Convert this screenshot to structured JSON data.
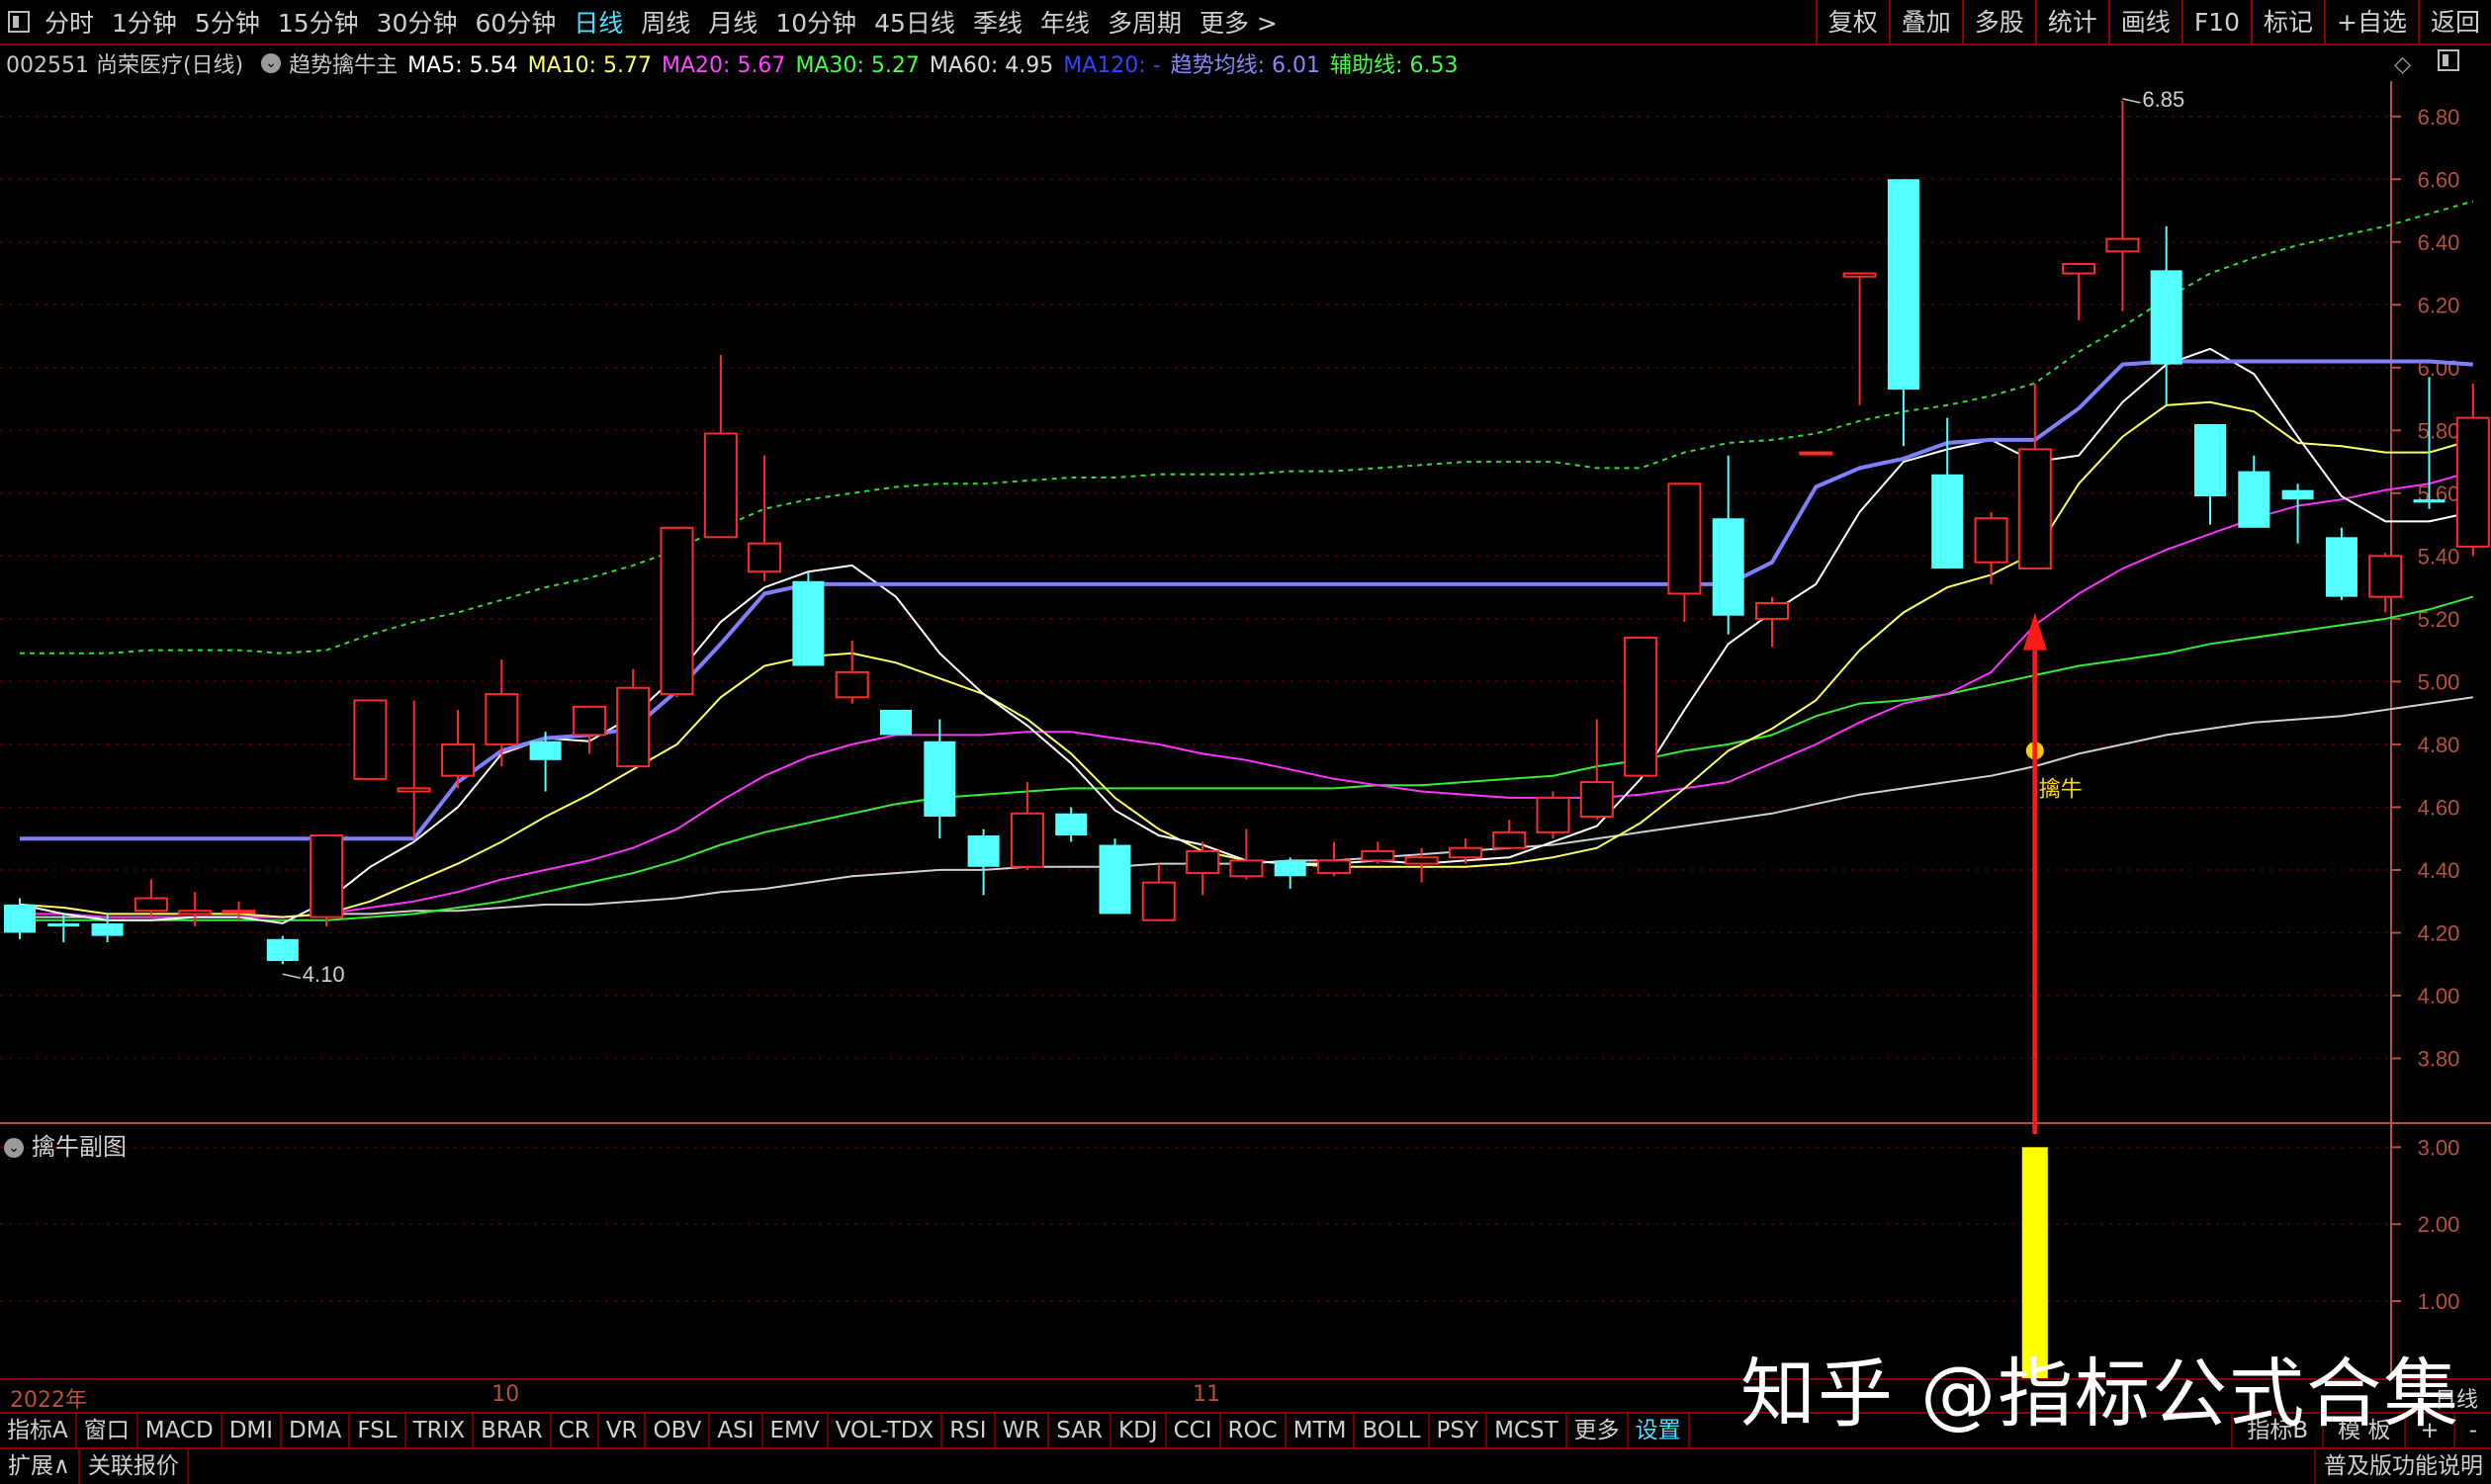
{
  "topbar": {
    "periods": [
      "分时",
      "1分钟",
      "5分钟",
      "15分钟",
      "30分钟",
      "60分钟",
      "日线",
      "周线",
      "月线",
      "10分钟",
      "45日线",
      "季线",
      "年线",
      "多周期",
      "更多 >"
    ],
    "active": "日线",
    "right_buttons": [
      "复权",
      "叠加",
      "多股",
      "统计",
      "画线",
      "F10",
      "标记",
      "+自选",
      "返回"
    ]
  },
  "info": {
    "code_name": "002551 尚荣医疗(日线)",
    "indicator": "趋势擒牛主",
    "items": [
      {
        "label": "MA5: 5.54",
        "color": "#ffffff"
      },
      {
        "label": "MA10: 5.77",
        "color": "#ffff66"
      },
      {
        "label": "MA20: 5.67",
        "color": "#ff44ff"
      },
      {
        "label": "MA30: 5.27",
        "color": "#44ff44"
      },
      {
        "label": "MA60: 4.95",
        "color": "#dddddd"
      },
      {
        "label": "MA120: -",
        "color": "#3344ff"
      },
      {
        "label": "趋势均线: 6.01",
        "color": "#8888ff"
      },
      {
        "label": "辅助线: 6.53",
        "color": "#44ff44"
      }
    ]
  },
  "colors": {
    "up": "#ff2a2a",
    "down": "#54ffff",
    "ma5": "#ffffff",
    "ma10": "#ffff66",
    "ma20": "#ff33ff",
    "ma30": "#33ee33",
    "ma60": "#d0d0d0",
    "trend": "#8080ff",
    "aux": "#33dd33",
    "axis": "#b8503a",
    "signal": "#ffff00",
    "arrow": "#ff1a1a"
  },
  "chart_data": {
    "type": "candlestick",
    "ylim": [
      3.6,
      6.9
    ],
    "yticks": [
      3.8,
      4.0,
      4.2,
      4.4,
      4.6,
      4.8,
      5.0,
      5.2,
      5.4,
      5.6,
      5.8,
      6.0,
      6.2,
      6.4,
      6.6,
      6.8
    ],
    "candles": [
      [
        4.29,
        4.2,
        4.31,
        4.18
      ],
      [
        4.23,
        4.22,
        4.26,
        4.17
      ],
      [
        4.23,
        4.19,
        4.26,
        4.17
      ],
      [
        4.27,
        4.31,
        4.37,
        4.25
      ],
      [
        4.26,
        4.27,
        4.33,
        4.22
      ],
      [
        4.27,
        4.27,
        4.3,
        4.24
      ],
      [
        4.18,
        4.11,
        4.19,
        4.1
      ],
      [
        4.25,
        4.51,
        4.51,
        4.22
      ],
      [
        4.69,
        4.94,
        4.94,
        4.69
      ],
      [
        4.65,
        4.66,
        4.94,
        4.5
      ],
      [
        4.7,
        4.8,
        4.91,
        4.66
      ],
      [
        4.8,
        4.96,
        5.07,
        4.73
      ],
      [
        4.81,
        4.75,
        4.84,
        4.65
      ],
      [
        4.83,
        4.92,
        4.92,
        4.77
      ],
      [
        4.73,
        4.98,
        5.04,
        4.73
      ],
      [
        4.96,
        5.49,
        5.49,
        4.95
      ],
      [
        5.46,
        5.79,
        6.04,
        5.46
      ],
      [
        5.35,
        5.44,
        5.72,
        5.32
      ],
      [
        5.32,
        5.05,
        5.35,
        5.05
      ],
      [
        4.95,
        5.03,
        5.13,
        4.93
      ],
      [
        4.91,
        4.83,
        4.91,
        4.83
      ],
      [
        4.81,
        4.57,
        4.88,
        4.5
      ],
      [
        4.51,
        4.41,
        4.53,
        4.32
      ],
      [
        4.41,
        4.58,
        4.68,
        4.4
      ],
      [
        4.58,
        4.51,
        4.6,
        4.49
      ],
      [
        4.48,
        4.26,
        4.5,
        4.26
      ],
      [
        4.24,
        4.36,
        4.42,
        4.24
      ],
      [
        4.39,
        4.46,
        4.49,
        4.32
      ],
      [
        4.38,
        4.43,
        4.53,
        4.37
      ],
      [
        4.43,
        4.38,
        4.44,
        4.34
      ],
      [
        4.39,
        4.43,
        4.49,
        4.38
      ],
      [
        4.43,
        4.46,
        4.49,
        4.42
      ],
      [
        4.42,
        4.44,
        4.47,
        4.36
      ],
      [
        4.44,
        4.47,
        4.5,
        4.42
      ],
      [
        4.47,
        4.52,
        4.56,
        4.47
      ],
      [
        4.52,
        4.63,
        4.65,
        4.5
      ],
      [
        4.57,
        4.68,
        4.88,
        4.56
      ],
      [
        4.7,
        5.14,
        5.14,
        4.7
      ],
      [
        5.28,
        5.63,
        5.63,
        5.19
      ],
      [
        5.52,
        5.21,
        5.72,
        5.15
      ],
      [
        5.2,
        5.25,
        5.27,
        5.11
      ],
      [
        5.73,
        5.73,
        5.73,
        5.73
      ],
      [
        6.29,
        6.3,
        6.3,
        5.88
      ],
      [
        6.6,
        5.93,
        6.6,
        5.75
      ],
      [
        5.66,
        5.36,
        5.84,
        5.36
      ],
      [
        5.38,
        5.52,
        5.54,
        5.31
      ],
      [
        5.36,
        5.74,
        5.95,
        5.36
      ],
      [
        6.3,
        6.33,
        6.33,
        6.15
      ],
      [
        6.37,
        6.41,
        6.85,
        6.18
      ],
      [
        6.31,
        6.01,
        6.45,
        5.88
      ],
      [
        5.82,
        5.59,
        5.82,
        5.5
      ],
      [
        5.67,
        5.49,
        5.72,
        5.49
      ],
      [
        5.61,
        5.58,
        5.63,
        5.44
      ],
      [
        5.46,
        5.27,
        5.49,
        5.26
      ],
      [
        5.27,
        5.4,
        5.41,
        5.22
      ],
      [
        5.58,
        5.57,
        5.97,
        5.55
      ],
      [
        5.43,
        5.84,
        5.95,
        5.4
      ]
    ],
    "ma5": [
      4.29,
      4.26,
      4.24,
      4.24,
      4.25,
      4.25,
      4.23,
      4.3,
      4.41,
      4.49,
      4.6,
      4.77,
      4.82,
      4.81,
      4.89,
      5.02,
      5.19,
      5.3,
      5.35,
      5.37,
      5.27,
      5.09,
      4.96,
      4.86,
      4.74,
      4.59,
      4.51,
      4.48,
      4.43,
      4.42,
      4.42,
      4.43,
      4.42,
      4.43,
      4.44,
      4.49,
      4.54,
      4.69,
      4.91,
      5.12,
      5.22,
      5.31,
      5.54,
      5.7,
      5.74,
      5.77,
      5.7,
      5.72,
      5.89,
      6.01,
      6.06,
      5.98,
      5.78,
      5.59,
      5.51,
      5.51,
      5.54
    ],
    "ma10": [
      4.29,
      4.28,
      4.26,
      4.26,
      4.26,
      4.26,
      4.25,
      4.26,
      4.3,
      4.36,
      4.42,
      4.49,
      4.57,
      4.64,
      4.72,
      4.8,
      4.95,
      5.05,
      5.08,
      5.09,
      5.06,
      5.01,
      4.96,
      4.88,
      4.77,
      4.63,
      4.53,
      4.46,
      4.43,
      4.42,
      4.41,
      4.41,
      4.41,
      4.41,
      4.42,
      4.44,
      4.47,
      4.55,
      4.66,
      4.78,
      4.85,
      4.94,
      5.1,
      5.22,
      5.3,
      5.34,
      5.41,
      5.63,
      5.78,
      5.88,
      5.89,
      5.86,
      5.76,
      5.75,
      5.73,
      5.73,
      5.77
    ],
    "ma20": [
      4.26,
      4.26,
      4.25,
      4.25,
      4.25,
      4.25,
      4.25,
      4.26,
      4.28,
      4.3,
      4.33,
      4.37,
      4.4,
      4.43,
      4.47,
      4.53,
      4.62,
      4.7,
      4.76,
      4.8,
      4.83,
      4.83,
      4.83,
      4.84,
      4.84,
      4.82,
      4.8,
      4.77,
      4.75,
      4.72,
      4.69,
      4.67,
      4.65,
      4.64,
      4.63,
      4.63,
      4.63,
      4.64,
      4.66,
      4.68,
      4.74,
      4.8,
      4.87,
      4.93,
      4.96,
      5.03,
      5.18,
      5.28,
      5.36,
      5.42,
      5.47,
      5.52,
      5.56,
      5.58,
      5.61,
      5.63,
      5.67
    ],
    "ma30": [
      4.24,
      4.24,
      4.24,
      4.24,
      4.24,
      4.24,
      4.24,
      4.24,
      4.25,
      4.26,
      4.28,
      4.3,
      4.33,
      4.36,
      4.39,
      4.43,
      4.48,
      4.52,
      4.55,
      4.58,
      4.61,
      4.63,
      4.64,
      4.65,
      4.66,
      4.66,
      4.66,
      4.66,
      4.66,
      4.66,
      4.66,
      4.67,
      4.67,
      4.68,
      4.69,
      4.7,
      4.73,
      4.75,
      4.78,
      4.8,
      4.83,
      4.89,
      4.93,
      4.94,
      4.96,
      4.99,
      5.02,
      5.05,
      5.07,
      5.09,
      5.12,
      5.14,
      5.16,
      5.18,
      5.2,
      5.23,
      5.27
    ],
    "ma60": [
      4.25,
      4.25,
      4.25,
      4.25,
      4.25,
      4.25,
      4.25,
      4.26,
      4.26,
      4.27,
      4.27,
      4.28,
      4.29,
      4.29,
      4.3,
      4.31,
      4.33,
      4.34,
      4.36,
      4.38,
      4.39,
      4.4,
      4.4,
      4.41,
      4.41,
      4.41,
      4.42,
      4.42,
      4.42,
      4.43,
      4.43,
      4.44,
      4.45,
      4.46,
      4.47,
      4.48,
      4.5,
      4.52,
      4.54,
      4.56,
      4.58,
      4.61,
      4.64,
      4.66,
      4.68,
      4.7,
      4.73,
      4.77,
      4.8,
      4.83,
      4.85,
      4.87,
      4.88,
      4.89,
      4.91,
      4.93,
      4.95
    ],
    "trend": [
      4.5,
      4.5,
      4.5,
      4.5,
      4.5,
      4.5,
      4.5,
      4.5,
      4.5,
      4.5,
      4.68,
      4.78,
      4.82,
      4.83,
      4.85,
      4.97,
      5.12,
      5.28,
      5.31,
      5.31,
      5.31,
      5.31,
      5.31,
      5.31,
      5.31,
      5.31,
      5.31,
      5.31,
      5.31,
      5.31,
      5.31,
      5.31,
      5.31,
      5.31,
      5.31,
      5.31,
      5.31,
      5.31,
      5.31,
      5.31,
      5.38,
      5.62,
      5.68,
      5.71,
      5.76,
      5.77,
      5.77,
      5.87,
      6.01,
      6.02,
      6.02,
      6.02,
      6.02,
      6.02,
      6.02,
      6.02,
      6.01
    ],
    "aux": [
      5.09,
      5.09,
      5.09,
      5.1,
      5.1,
      5.1,
      5.09,
      5.1,
      5.15,
      5.19,
      5.22,
      5.26,
      5.3,
      5.33,
      5.37,
      5.42,
      5.49,
      5.55,
      5.58,
      5.6,
      5.62,
      5.63,
      5.63,
      5.64,
      5.65,
      5.65,
      5.66,
      5.66,
      5.66,
      5.67,
      5.67,
      5.68,
      5.69,
      5.7,
      5.7,
      5.7,
      5.68,
      5.68,
      5.73,
      5.76,
      5.77,
      5.79,
      5.83,
      5.86,
      5.88,
      5.91,
      5.95,
      6.05,
      6.13,
      6.22,
      6.3,
      6.35,
      6.39,
      6.42,
      6.45,
      6.49,
      6.53
    ],
    "annotations": [
      {
        "text": "6.85",
        "index": 48,
        "price": 6.85
      },
      {
        "text": "4.10",
        "index": 6,
        "price": 4.1
      },
      {
        "text": "擒牛",
        "index": 46,
        "price": 4.78
      }
    ],
    "signal": {
      "index": 46,
      "value": 3.0
    },
    "sub_ylim": [
      0,
      3.3
    ],
    "sub_yticks": [
      1.0,
      2.0,
      3.0
    ],
    "x_labels": [
      {
        "text": "2022年",
        "index": 0
      },
      {
        "text": "10",
        "index": 11
      },
      {
        "text": "11",
        "index": 27
      }
    ],
    "x_right_label": "日线"
  },
  "subchart": {
    "title": "擒牛副图"
  },
  "tabs": [
    "指标A",
    "窗口",
    "MACD",
    "DMI",
    "DMA",
    "FSL",
    "TRIX",
    "BRAR",
    "CR",
    "VR",
    "OBV",
    "ASI",
    "EMV",
    "VOL-TDX",
    "RSI",
    "WR",
    "SAR",
    "KDJ",
    "CCI",
    "ROC",
    "MTM",
    "BOLL",
    "PSY",
    "MCST",
    "更多",
    "设置"
  ],
  "tabs_right": [
    "指标B",
    "模 板",
    "+",
    "-"
  ],
  "status": {
    "left": [
      "扩展∧",
      "关联报价"
    ],
    "right": "普及版功能说明"
  },
  "watermark": "知乎 @指标公式合集"
}
